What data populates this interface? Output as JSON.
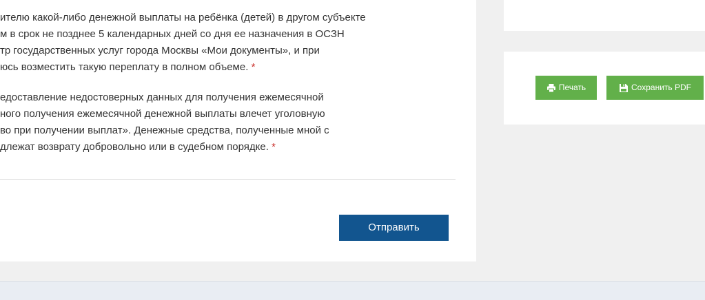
{
  "form": {
    "paragraph_1": [
      "ителю какой-либо денежной выплаты на ребёнка (детей) в другом субъекте",
      "м в срок не позднее 5 календарных дней со дня ее назначения в ОСЗН",
      "тр государственных услуг города Москвы «Мои документы», и при",
      "юсь возместить такую переплату в полном объеме."
    ],
    "paragraph_2": [
      "едоставление недостоверных данных для получения ежемесячной",
      "ного получения ежемесячной денежной выплаты влечет уголовную",
      "во при получении выплат». Денежные средства, полученные мной с",
      "длежат возврату добровольно или в судебном порядке."
    ],
    "required_mark": "*",
    "submit_label": "Отправить"
  },
  "sidebar": {
    "print_label": "Печать",
    "print_icon": "printer-icon",
    "save_pdf_label": "Сохранить PDF",
    "save_pdf_icon": "save-pdf-icon"
  },
  "colors": {
    "submit_button": "#12558f",
    "action_button": "#62b04a",
    "required_mark": "#c9302c"
  }
}
